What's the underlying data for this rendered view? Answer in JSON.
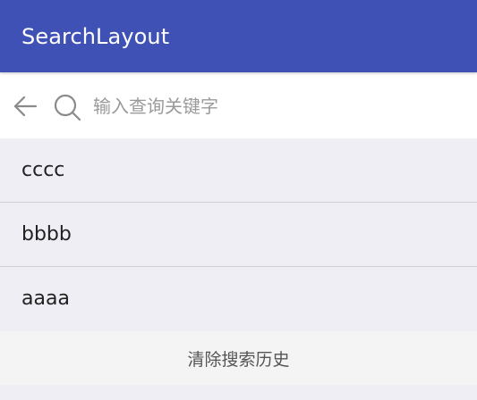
{
  "app_bar": {
    "title": "SearchLayout",
    "color": "#3f51b5"
  },
  "search": {
    "placeholder": "输入查询关键字",
    "value": "",
    "back_icon": "arrow-left-icon",
    "search_icon": "search-icon"
  },
  "history": {
    "items": [
      {
        "label": "cccc"
      },
      {
        "label": "bbbb"
      },
      {
        "label": "aaaa"
      }
    ],
    "clear_label": "清除搜索历史"
  }
}
